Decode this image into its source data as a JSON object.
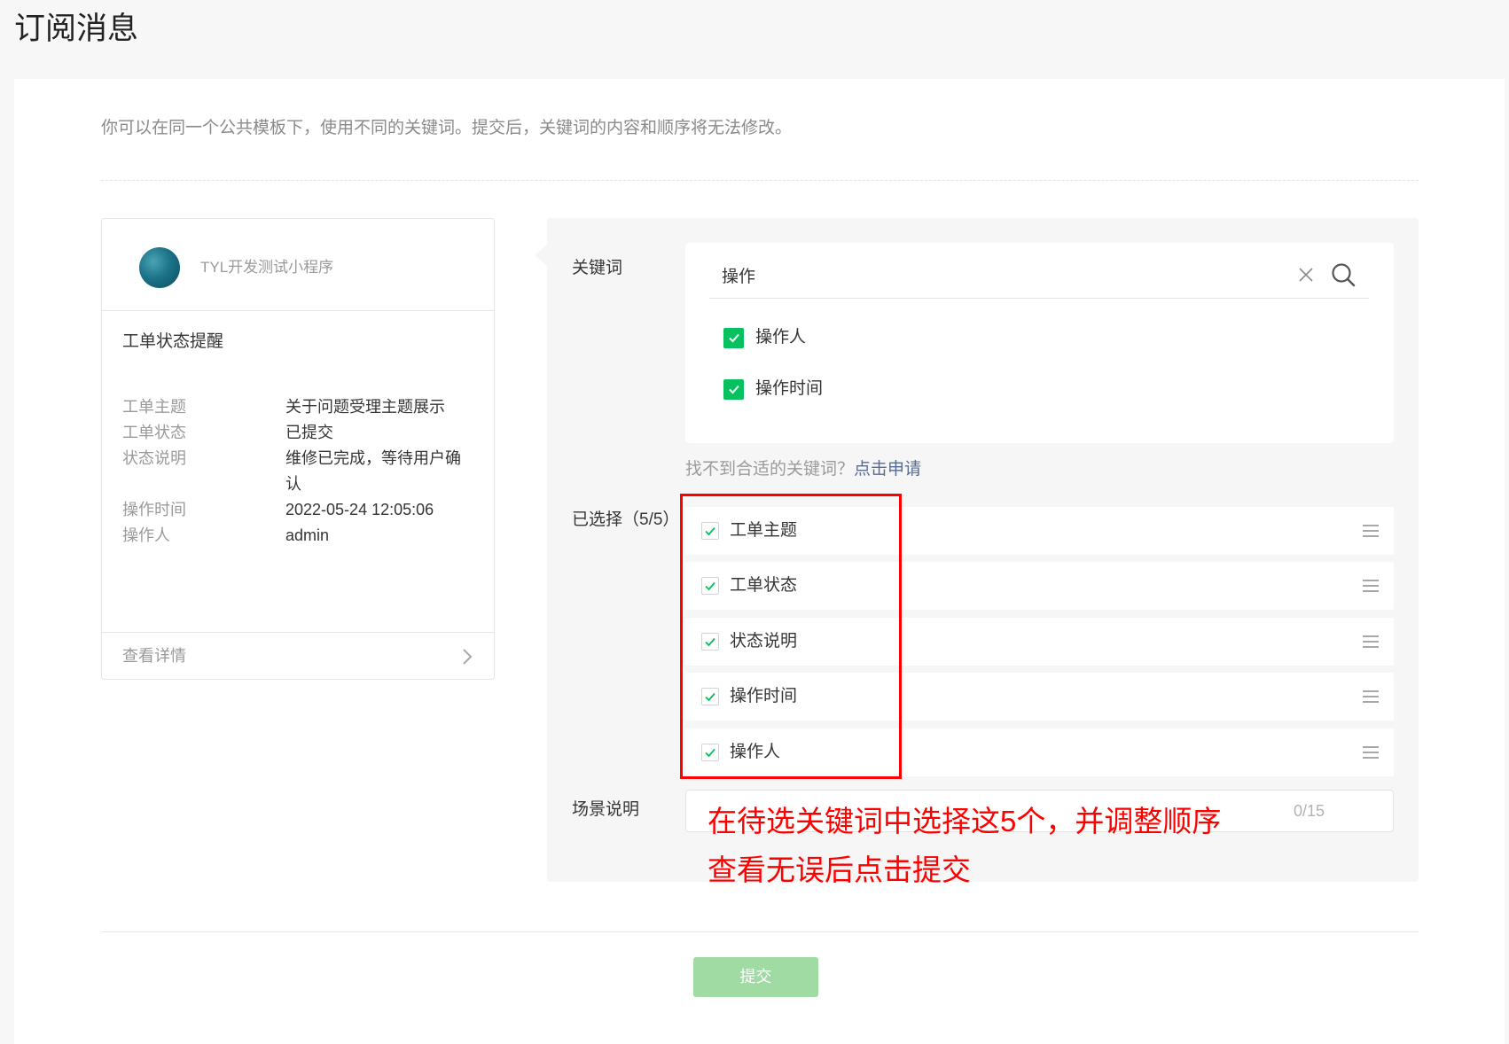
{
  "page": {
    "title": "订阅消息",
    "notice": "你可以在同一个公共模板下，使用不同的关键词。提交后，关键词的内容和顺序将无法修改。"
  },
  "preview": {
    "avatar_icon": "app-avatar",
    "app_name": "TYL开发测试小程序",
    "template_title": "工单状态提醒",
    "fields": [
      {
        "label": "工单主题",
        "value": "关于问题受理主题展示"
      },
      {
        "label": "工单状态",
        "value": "已提交"
      },
      {
        "label": "状态说明",
        "value": "维修已完成，等待用户确认"
      },
      {
        "label": "操作时间",
        "value": "2022-05-24 12:05:06"
      },
      {
        "label": "操作人",
        "value": "admin"
      }
    ],
    "detail_link": "查看详情",
    "detail_icon": "chevron-right-icon"
  },
  "keywords": {
    "label": "关键词",
    "search_value": "操作",
    "clear_icon": "close-icon",
    "search_icon": "search-icon",
    "results": [
      {
        "label": "操作人",
        "checked": true
      },
      {
        "label": "操作时间",
        "checked": true
      }
    ],
    "not_found_text": "找不到合适的关键词？",
    "apply_link": "点击申请"
  },
  "selected": {
    "label": "已选择（5/5）",
    "drag_icon": "drag-handle-icon",
    "items": [
      {
        "label": "工单主题",
        "checked": true
      },
      {
        "label": "工单状态",
        "checked": true
      },
      {
        "label": "状态说明",
        "checked": true
      },
      {
        "label": "操作时间",
        "checked": true
      },
      {
        "label": "操作人",
        "checked": true
      }
    ]
  },
  "scene": {
    "label": "场景说明",
    "value": "",
    "counter": "0/15"
  },
  "annotation": {
    "lines": [
      "在待选关键词中选择这5个，并调整顺序",
      "查看无误后点击提交"
    ]
  },
  "submit": {
    "label": "提交",
    "enabled": false
  },
  "colors": {
    "accent": "#07c160",
    "link": "#576b95",
    "annotation": "#ff0000",
    "submit_bg": "#9fdba3",
    "editor_bg": "#f6f6f6"
  }
}
